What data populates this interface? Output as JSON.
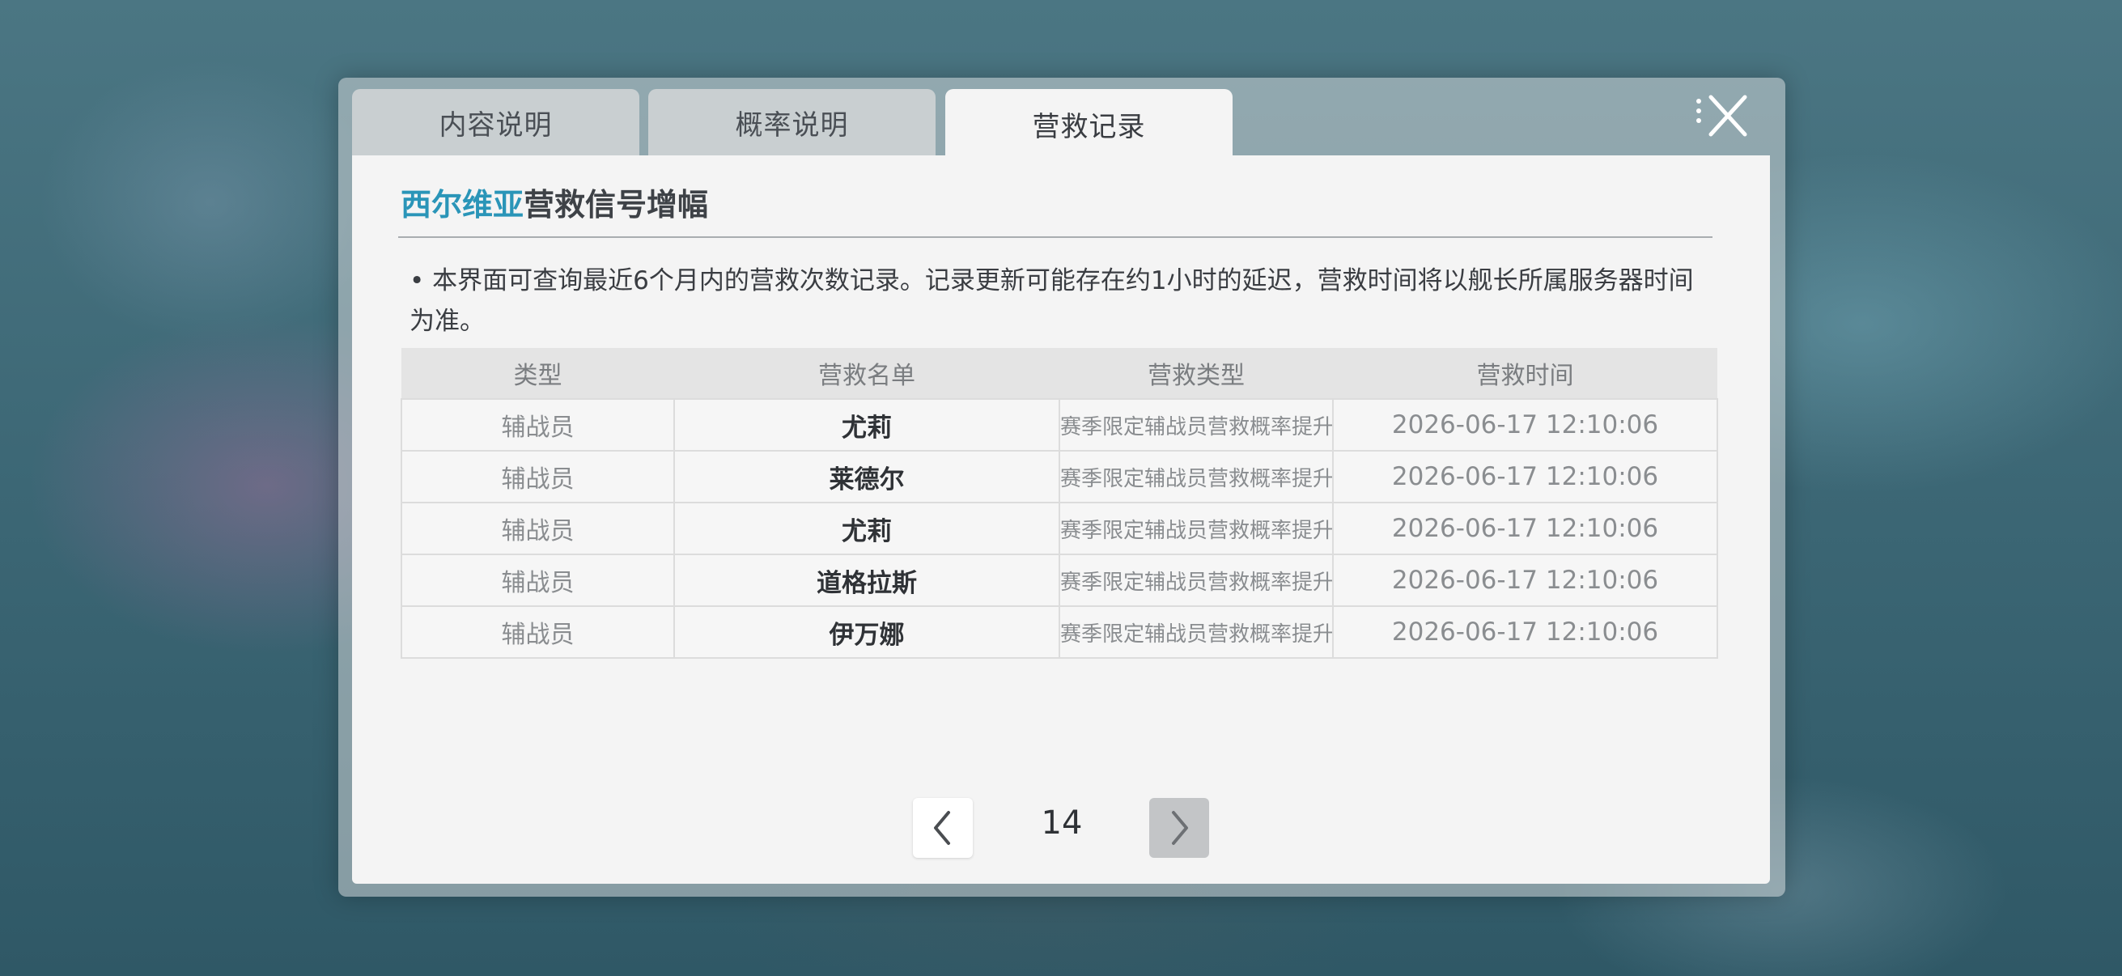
{
  "tabs": [
    {
      "label": "内容说明",
      "active": false
    },
    {
      "label": "概率说明",
      "active": false
    },
    {
      "label": "营救记录",
      "active": true
    }
  ],
  "title": {
    "highlight": "西尔维亚",
    "text": "营救信号增幅",
    "highlight_color": "#2a95b8"
  },
  "notice": "• 本界面可查询最近6个月内的营救次数记录。记录更新可能存在约1小时的延迟，营救时间将以舰长所属服务器时间为准。",
  "table": {
    "headers": [
      "类型",
      "营救名单",
      "营救类型",
      "营救时间"
    ],
    "rows": [
      [
        "辅战员",
        "尤莉",
        "赛季限定辅战员营救概率提升",
        "2026-06-17 12:10:06"
      ],
      [
        "辅战员",
        "莱德尔",
        "赛季限定辅战员营救概率提升",
        "2026-06-17 12:10:06"
      ],
      [
        "辅战员",
        "尤莉",
        "赛季限定辅战员营救概率提升",
        "2026-06-17 12:10:06"
      ],
      [
        "辅战员",
        "道格拉斯",
        "赛季限定辅战员营救概率提升",
        "2026-06-17 12:10:06"
      ],
      [
        "辅战员",
        "伊万娜",
        "赛季限定辅战员营救概率提升",
        "2026-06-17 12:10:06"
      ]
    ]
  },
  "pagination": {
    "page": "14"
  },
  "icons": {
    "close": "close-icon",
    "prev": "chevron-left-icon",
    "next": "chevron-right-icon"
  }
}
